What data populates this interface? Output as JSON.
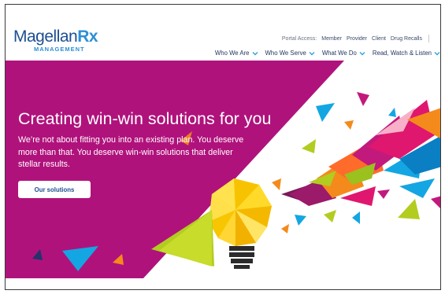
{
  "brand": {
    "name_part1": "Magellan",
    "name_part2": "Rx",
    "tagline": "MANAGEMENT"
  },
  "utility_nav": {
    "label": "Portal Access:",
    "links": [
      "Member",
      "Provider",
      "Client",
      "Drug Recalls"
    ]
  },
  "main_nav": {
    "items": [
      "Who We Are",
      "Who We Serve",
      "What We Do",
      "Read, Watch & Listen"
    ]
  },
  "hero": {
    "headline": "Creating win-win solutions for you",
    "body": "We’re not about fitting you into an existing plan. You deserve more than that. You deserve win-win solutions that deliver stellar results.",
    "cta_label": "Our solutions"
  },
  "colors": {
    "brand_navy": "#1d4f91",
    "brand_blue": "#2d8fd5",
    "hero_magenta": "#b0127c",
    "chevron": "#2aa3e0"
  }
}
